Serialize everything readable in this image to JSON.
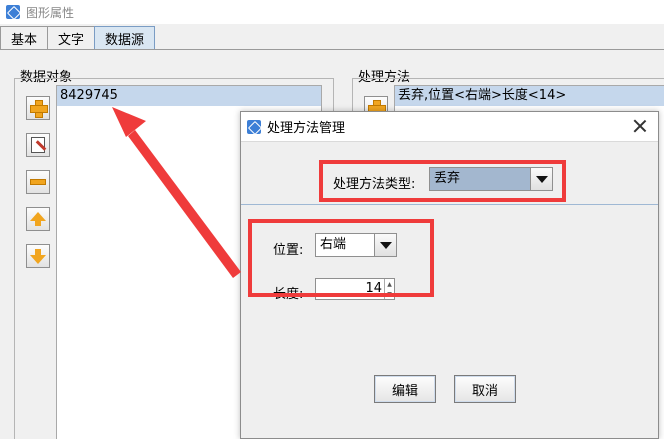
{
  "window": {
    "title": "图形属性"
  },
  "tabs": [
    {
      "label": "基本",
      "active": false
    },
    {
      "label": "文字",
      "active": false
    },
    {
      "label": "数据源",
      "active": true
    }
  ],
  "data_objects": {
    "label": "数据对象",
    "items": [
      "8429745"
    ]
  },
  "processing": {
    "label": "处理方法",
    "items": [
      "丢弃,位置<右端>长度<14>"
    ]
  },
  "dialog": {
    "title": "处理方法管理",
    "type_label": "处理方法类型:",
    "type_value": "丢弃",
    "position_label": "位置:",
    "position_value": "右端",
    "length_label": "长度:",
    "length_value": "14",
    "edit_button": "编辑",
    "cancel_button": "取消"
  },
  "colors": {
    "highlight": "#ef3b3b",
    "selection": "#c5d7ec",
    "active_tab": "#d9e6f2"
  }
}
